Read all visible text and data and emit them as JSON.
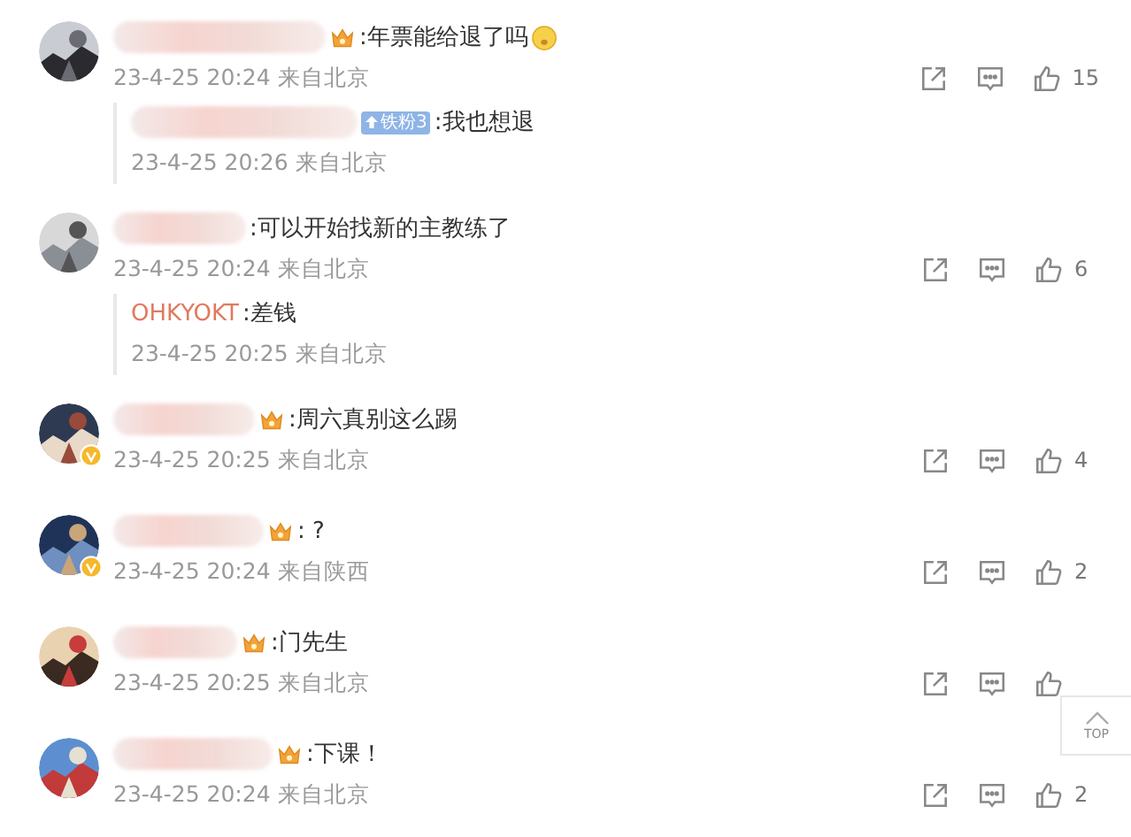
{
  "comments": [
    {
      "crown": true,
      "emoji": true,
      "verified": false,
      "text": ":年票能给退了吗",
      "time": "23-4-25 20:24",
      "location": "来自北京",
      "likes": "15",
      "replies": [
        {
          "fan_badge": "铁粉3",
          "text": ":我也想退",
          "time": "23-4-25 20:26",
          "location": "来自北京"
        }
      ]
    },
    {
      "crown": false,
      "emoji": false,
      "verified": false,
      "text": ":可以开始找新的主教练了",
      "time": "23-4-25 20:24",
      "location": "来自北京",
      "likes": "6",
      "replies": [
        {
          "user": "OHKYOKT",
          "text": ":差钱",
          "time": "23-4-25 20:25",
          "location": "来自北京"
        }
      ]
    },
    {
      "crown": true,
      "emoji": false,
      "verified": true,
      "text": ":周六真别这么踢",
      "time": "23-4-25 20:25",
      "location": "来自北京",
      "likes": "4"
    },
    {
      "crown": true,
      "emoji": false,
      "verified": true,
      "text": ": ?",
      "time": "23-4-25 20:24",
      "location": "来自陕西",
      "likes": "2"
    },
    {
      "crown": true,
      "emoji": false,
      "verified": false,
      "text": ":门先生",
      "time": "23-4-25 20:25",
      "location": "来自北京"
    },
    {
      "crown": true,
      "emoji": false,
      "verified": false,
      "text": ":下课！",
      "time": "23-4-25 20:24",
      "location": "来自北京",
      "likes": "2"
    }
  ],
  "back_to_top": {
    "label": "TOP"
  }
}
